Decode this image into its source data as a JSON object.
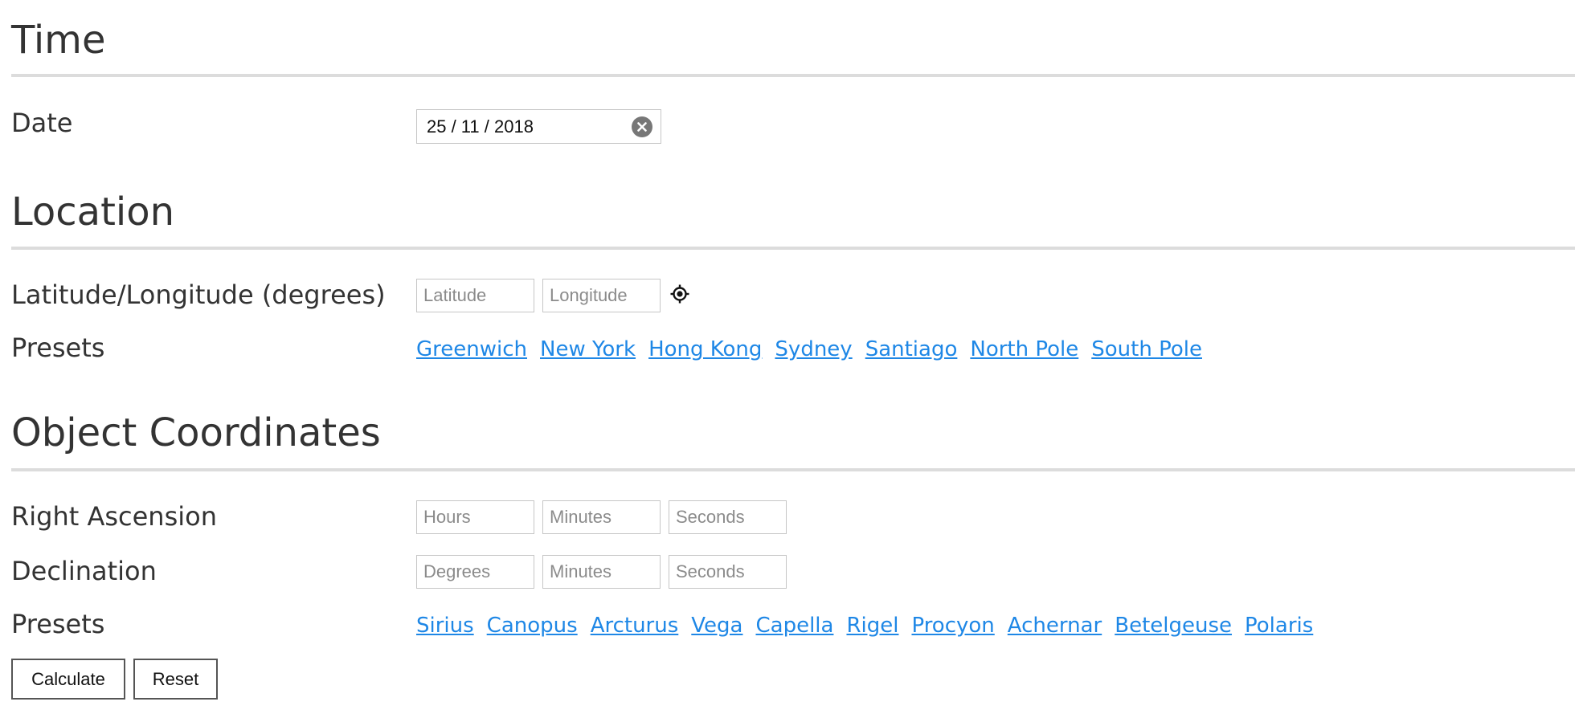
{
  "time": {
    "heading": "Time",
    "date_label": "Date",
    "date_value": "25 / 11 / 2018"
  },
  "location": {
    "heading": "Location",
    "latlon_label": "Latitude/Longitude (degrees)",
    "latitude_placeholder": "Latitude",
    "longitude_placeholder": "Longitude",
    "presets_label": "Presets",
    "presets": [
      "Greenwich",
      "New York",
      "Hong Kong",
      "Sydney",
      "Santiago",
      "North Pole",
      "South Pole"
    ]
  },
  "object": {
    "heading": "Object Coordinates",
    "ra_label": "Right Ascension",
    "ra_hours_placeholder": "Hours",
    "ra_minutes_placeholder": "Minutes",
    "ra_seconds_placeholder": "Seconds",
    "dec_label": "Declination",
    "dec_degrees_placeholder": "Degrees",
    "dec_minutes_placeholder": "Minutes",
    "dec_seconds_placeholder": "Seconds",
    "presets_label": "Presets",
    "presets": [
      "Sirius",
      "Canopus",
      "Arcturus",
      "Vega",
      "Capella",
      "Rigel",
      "Procyon",
      "Achernar",
      "Betelgeuse",
      "Polaris"
    ]
  },
  "buttons": {
    "calculate": "Calculate",
    "reset": "Reset"
  },
  "icons": {
    "clear": "clear-circle-icon",
    "locate": "crosshair-locate-icon"
  }
}
